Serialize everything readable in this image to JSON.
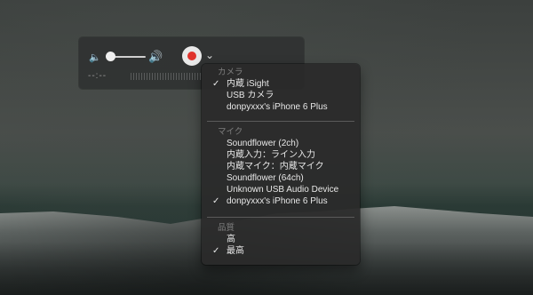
{
  "player": {
    "time": "--:--",
    "icons": {
      "volume_low": "speaker-low-icon",
      "volume_high": "speaker-high-icon",
      "record": "record-icon",
      "options": "chevron-down-icon"
    },
    "record_color": "#e0332c"
  },
  "menu": {
    "camera": {
      "header": "カメラ",
      "items": [
        {
          "label": "内蔵 iSight",
          "checked": true
        },
        {
          "label": "USB カメラ",
          "checked": false
        },
        {
          "label": "donpyxxx's iPhone 6 Plus",
          "checked": false
        }
      ]
    },
    "mic": {
      "header": "マイク",
      "items": [
        {
          "label": "Soundflower (2ch)",
          "checked": false
        },
        {
          "label": "内蔵入力：ライン入力",
          "checked": false
        },
        {
          "label": "内蔵マイク：内蔵マイク",
          "checked": false
        },
        {
          "label": "Soundflower (64ch)",
          "checked": false
        },
        {
          "label": "Unknown USB Audio Device",
          "checked": false
        },
        {
          "label": "donpyxxx's iPhone 6 Plus",
          "checked": true
        }
      ]
    },
    "quality": {
      "header": "品質",
      "items": [
        {
          "label": "高",
          "checked": false
        },
        {
          "label": "最高",
          "checked": true
        }
      ]
    },
    "checkmark": "✓"
  }
}
